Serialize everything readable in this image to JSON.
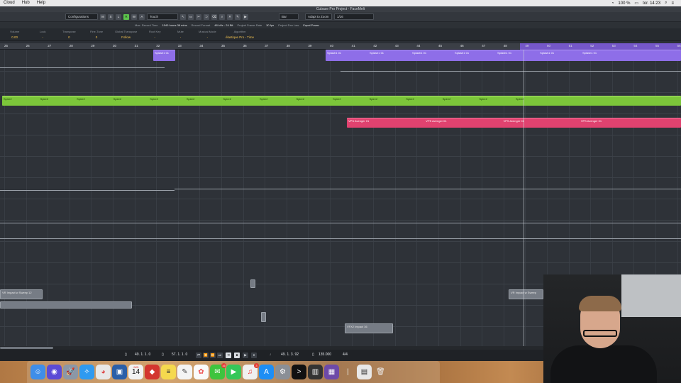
{
  "menubar": {
    "items": [
      "Cloud",
      "Hub",
      "Help"
    ],
    "battery": "100 %",
    "clock": "tor. 14:23"
  },
  "window": {
    "title": "Cubase Pro Project - FaceMelt"
  },
  "toolbar": {
    "configurations": "Configurations",
    "mode_buttons": [
      "M",
      "S",
      "L",
      "R",
      "W",
      "A"
    ],
    "automation_mode": "Touch",
    "zoom_mode": "Adapt to Zoom",
    "quantize": "1/16",
    "grid_label": "Bar"
  },
  "infoline": {
    "max_record_time_label": "Max. Record Time",
    "max_record_time": "1540 hours 38 mins",
    "record_format_label": "Record Format",
    "record_format": "48 kHz - 24 Bit",
    "frame_rate_label": "Project Frame Rate",
    "frame_rate": "30 fps",
    "pan_law_label": "Project Pan Law",
    "pan_law": "Equal Power"
  },
  "params": [
    {
      "label": "Volume",
      "value": "0.00"
    },
    {
      "label": "Lock",
      "value": "-"
    },
    {
      "label": "Transpose",
      "value": "0"
    },
    {
      "label": "Fine-Tune",
      "value": "0"
    },
    {
      "label": "Global Transpose",
      "value": "Follow"
    },
    {
      "label": "Root Key",
      "value": "-"
    },
    {
      "label": "Mute",
      "value": "-"
    },
    {
      "label": "Musical Mode",
      "value": "-"
    },
    {
      "label": "Algorithm",
      "value": "élastique Pro - Time"
    }
  ],
  "ruler": {
    "bars": [
      "25",
      "26",
      "27",
      "28",
      "29",
      "30",
      "31",
      "32",
      "33",
      "34",
      "35",
      "36",
      "37",
      "38",
      "39",
      "40",
      "41",
      "42",
      "43",
      "44",
      "45",
      "46",
      "47",
      "48",
      "49",
      "50",
      "51",
      "52",
      "53",
      "54",
      "55",
      "56"
    ]
  },
  "clips": {
    "synth_label_a": "Splash1 01",
    "synth_label_b": "Splash1 01",
    "spiral_label": "Spire2",
    "avenger_label": "VPS Avenger 01",
    "impact_label": "VR Impact w Sweep 12",
    "impact_label_2": "VR Impact w Sweep",
    "impact_label_3": "VFX2 Impact 36"
  },
  "transport": {
    "left_locator": "49. 1. 1. 0",
    "right_locator": "57. 1. 1. 0",
    "position": "49. 1. 3. 92",
    "tempo": "135.000",
    "signature": "4/4"
  },
  "dock": {
    "calendar_day": "14",
    "calendar_month": "JUN",
    "messages_badge": "16",
    "itunes_badge": "3"
  }
}
